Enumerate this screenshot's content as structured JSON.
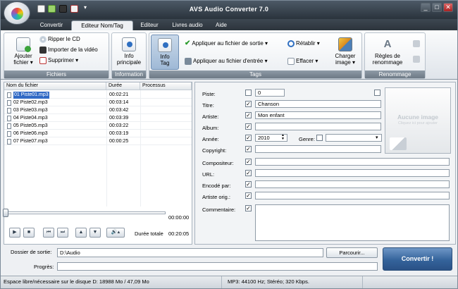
{
  "window": {
    "title": "AVS Audio Converter  7.0"
  },
  "quick_access": {
    "icons": [
      "new-file-icon",
      "add-files-icon",
      "video-icon",
      "delete-icon"
    ],
    "menu": "▾"
  },
  "window_controls": {
    "minimize": "_",
    "maximize": "□",
    "close": "✕"
  },
  "tabs": [
    {
      "label": "Convertir"
    },
    {
      "label": "Editeur Nom/Tag",
      "active": true
    },
    {
      "label": "Editeur"
    },
    {
      "label": "Livres audio"
    },
    {
      "label": "Aide"
    }
  ],
  "ribbon": {
    "fichiers": {
      "caption": "Fichiers",
      "add_label_1": "Ajouter",
      "add_label_2": "fichier ▾",
      "rip": "Ripper le CD",
      "import_video": "Importer de la vidéo",
      "delete": "Supprimer ▾"
    },
    "information": {
      "caption": "Information",
      "info_1": "Info",
      "info_2": "principale"
    },
    "tags": {
      "caption": "Tags",
      "info_1": "Info",
      "info_2": "Tag",
      "apply_out": "Appliquer au fichier de sortie ▾",
      "apply_in": "Appliquer au fichier d'entrée ▾",
      "restore": "Rétablir ▾",
      "clear": "Effacer ▾",
      "load_1": "Charger",
      "load_2": "image ▾"
    },
    "renommage": {
      "caption": "Renommage",
      "rules_1": "Règles de",
      "rules_2": "renommage"
    }
  },
  "filelist": {
    "columns": {
      "name": "Nom du fichier",
      "duration": "Durée",
      "process": "Processus"
    },
    "rows": [
      {
        "name": "01 Piste01.mp3",
        "duration": "00:02:21",
        "selected": true
      },
      {
        "name": "02 Piste02.mp3",
        "duration": "00:03:14"
      },
      {
        "name": "03 Piste03.mp3",
        "duration": "00:03:42"
      },
      {
        "name": "04 Piste04.mp3",
        "duration": "00:03:39"
      },
      {
        "name": "05 Piste05.mp3",
        "duration": "00:03:22"
      },
      {
        "name": "06 Piste06.mp3",
        "duration": "00:03:19"
      },
      {
        "name": "07 Piste07.mp3",
        "duration": "00:00:25"
      }
    ]
  },
  "player": {
    "position": "00:00:00",
    "total_label": "Durée totale",
    "total": "00:20:05",
    "buttons": {
      "play": "▶",
      "stop": "■",
      "prev": "⏮",
      "next": "⏭",
      "up": "▲",
      "down": "▼",
      "volume": "🔊▴"
    }
  },
  "tags": {
    "track": {
      "label": "Piste:",
      "value": "0"
    },
    "title": {
      "label": "Titre:",
      "value": "Chanson"
    },
    "artist": {
      "label": "Artiste:",
      "value": "Mon enfant"
    },
    "album": {
      "label": "Album:",
      "value": ""
    },
    "year": {
      "label": "Année:",
      "value": "2010"
    },
    "genre": {
      "label": "Genre:",
      "value": ""
    },
    "copyright": {
      "label": "Copyright:",
      "value": ""
    },
    "composer": {
      "label": "Compositeur:",
      "value": ""
    },
    "url": {
      "label": "URL:",
      "value": ""
    },
    "encoded": {
      "label": "Encodé par:",
      "value": ""
    },
    "orig_artist": {
      "label": "Artiste orig.:",
      "value": ""
    },
    "comment": {
      "label": "Commentaire:",
      "value": ""
    }
  },
  "cover": {
    "title": "Aucune image",
    "hint": "Cliquez ici pour ajouter"
  },
  "output": {
    "folder_label": "Dossier de sortie:",
    "folder_value": "D:\\Audio",
    "browse": "Parcourir...",
    "progress_label": "Progrès:",
    "convert": "Convertir !"
  },
  "status": {
    "disk": "Espace libre/nécessaire sur le disque D: 18988 Mo / 47,09 Mo",
    "format": "MP3: 44100  Hz; Stéréo; 320 Kbps."
  }
}
